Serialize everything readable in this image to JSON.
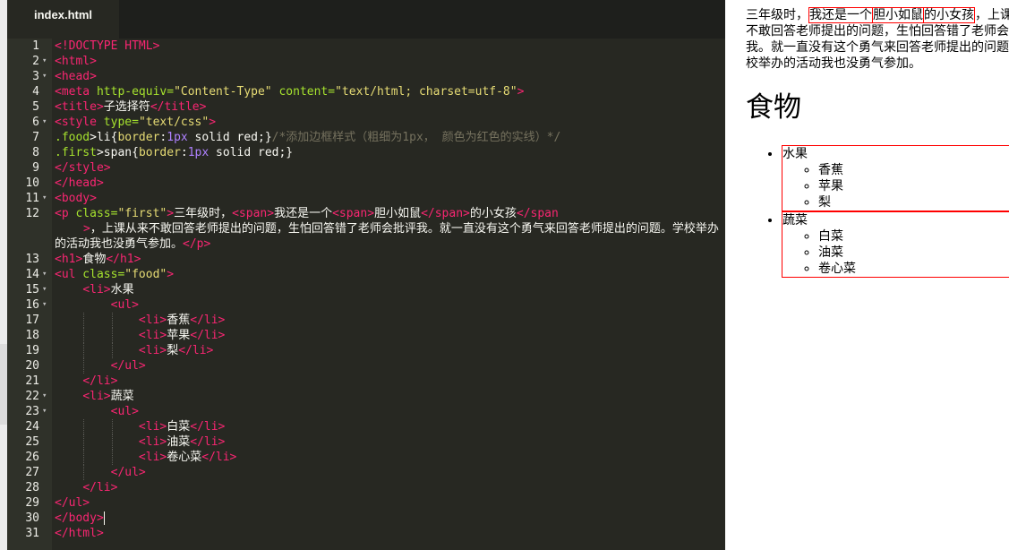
{
  "tab": {
    "label": "index.html"
  },
  "code_lines": [
    {
      "n": "1",
      "fold": ""
    },
    {
      "n": "2",
      "fold": "▾"
    },
    {
      "n": "3",
      "fold": "▾"
    },
    {
      "n": "4",
      "fold": ""
    },
    {
      "n": "5",
      "fold": ""
    },
    {
      "n": "6",
      "fold": "▾"
    },
    {
      "n": "7",
      "fold": ""
    },
    {
      "n": "8",
      "fold": ""
    },
    {
      "n": "9",
      "fold": ""
    },
    {
      "n": "10",
      "fold": ""
    },
    {
      "n": "11",
      "fold": "▾"
    },
    {
      "n": "12",
      "fold": ""
    },
    {
      "n": "13",
      "fold": ""
    },
    {
      "n": "14",
      "fold": "▾"
    },
    {
      "n": "15",
      "fold": "▾"
    },
    {
      "n": "16",
      "fold": "▾"
    },
    {
      "n": "17",
      "fold": ""
    },
    {
      "n": "18",
      "fold": ""
    },
    {
      "n": "19",
      "fold": ""
    },
    {
      "n": "20",
      "fold": ""
    },
    {
      "n": "21",
      "fold": ""
    },
    {
      "n": "22",
      "fold": "▾"
    },
    {
      "n": "23",
      "fold": "▾"
    },
    {
      "n": "24",
      "fold": ""
    },
    {
      "n": "25",
      "fold": ""
    },
    {
      "n": "26",
      "fold": ""
    },
    {
      "n": "27",
      "fold": ""
    },
    {
      "n": "28",
      "fold": ""
    },
    {
      "n": "29",
      "fold": ""
    },
    {
      "n": "30",
      "fold": ""
    },
    {
      "n": "31",
      "fold": ""
    }
  ],
  "code": {
    "l1": "<!DOCTYPE HTML>",
    "l2": "<html>",
    "l3": "<head>",
    "l4_open": "<meta",
    "l4_a1": " http-equiv=",
    "l4_v1": "\"Content-Type\"",
    "l4_a2": " content=",
    "l4_v2": "\"text/html; charset=utf-8\"",
    "l4_close": ">",
    "l5_open": "<title>",
    "l5_text": "子选择符",
    "l5_close": "</title>",
    "l6_open": "<style",
    "l6_a1": " type=",
    "l6_v1": "\"text/css\"",
    "l6_close": ">",
    "l7_sel": ".food",
    "l7_plain1": ">li{",
    "l7_prop": "border",
    "l7_colon": ":",
    "l7_num": "1px",
    "l7_rest": " solid red;}",
    "l7_cmt": "/*添加边框样式（粗细为1px， 颜色为红色的实线）*/",
    "l8_sel": ".first",
    "l8_plain1": ">span{",
    "l8_prop": "border",
    "l8_colon": ":",
    "l8_num": "1px",
    "l8_rest": " solid red;}",
    "l9": "</style>",
    "l10": "</head>",
    "l11": "<body>",
    "l12_p_open": "<p",
    "l12_a1": " class=",
    "l12_v1": "\"first\"",
    "l12_gt": ">",
    "l12_t1": "三年级时，",
    "l12_span1": "<span>",
    "l12_t2": "我还是一个",
    "l12_span2": "<span>",
    "l12_t3": "胆小如鼠",
    "l12_span2c": "</span>",
    "l12_t4": "的小女孩",
    "l12_span1c_a": "</span",
    "l12_span1c_b": ">",
    "l12_t5": "，上课从来不敢回答老师提出的问题，生怕回答错了老师会批评我。就一直没有这个勇气来回答老师提出的问题。学校举办的活动我也没勇气参加。",
    "l12_pc": "</p>",
    "l13_open": "<h1>",
    "l13_text": "食物",
    "l13_close": "</h1>",
    "l14_open": "<ul",
    "l14_a1": " class=",
    "l14_v1": "\"food\"",
    "l14_close": ">",
    "l15_open": "<li>",
    "l15_text": "水果",
    "l16": "<ul>",
    "l17_open": "<li>",
    "l17_text": "香蕉",
    "l17_close": "</li>",
    "l18_open": "<li>",
    "l18_text": "苹果",
    "l18_close": "</li>",
    "l19_open": "<li>",
    "l19_text": "梨",
    "l19_close": "</li>",
    "l20": "</ul>",
    "l21": "</li>",
    "l22_open": "<li>",
    "l22_text": "蔬菜",
    "l23": "<ul>",
    "l24_open": "<li>",
    "l24_text": "白菜",
    "l24_close": "</li>",
    "l25_open": "<li>",
    "l25_text": "油菜",
    "l25_close": "</li>",
    "l26_open": "<li>",
    "l26_text": "卷心菜",
    "l26_close": "</li>",
    "l27": "</ul>",
    "l28": "</li>",
    "l29": "</ul>",
    "l30": "</body>",
    "l31": "</html>"
  },
  "preview": {
    "p_t1": "三年级时，",
    "p_t2": "我还是一个",
    "p_t3": "胆小如鼠",
    "p_t4": "的小女孩",
    "p_t5": "，上课从来不敢回答老师提出的问题，生怕回答错了老师会批评我。就一直没有这个勇气来回答老师提出的问题。学校举办的活动我也没勇气参加。",
    "h1": "食物",
    "groups": [
      {
        "label": "水果",
        "items": [
          "香蕉",
          "苹果",
          "梨"
        ]
      },
      {
        "label": "蔬菜",
        "items": [
          "白菜",
          "油菜",
          "卷心菜"
        ]
      }
    ]
  },
  "colors": {
    "editor_bg": "#272822",
    "tag": "#f92672",
    "attr": "#a6e22e",
    "string": "#e6db74",
    "comment": "#75715e",
    "number": "#ae81ff",
    "border_red": "#ff0000"
  }
}
